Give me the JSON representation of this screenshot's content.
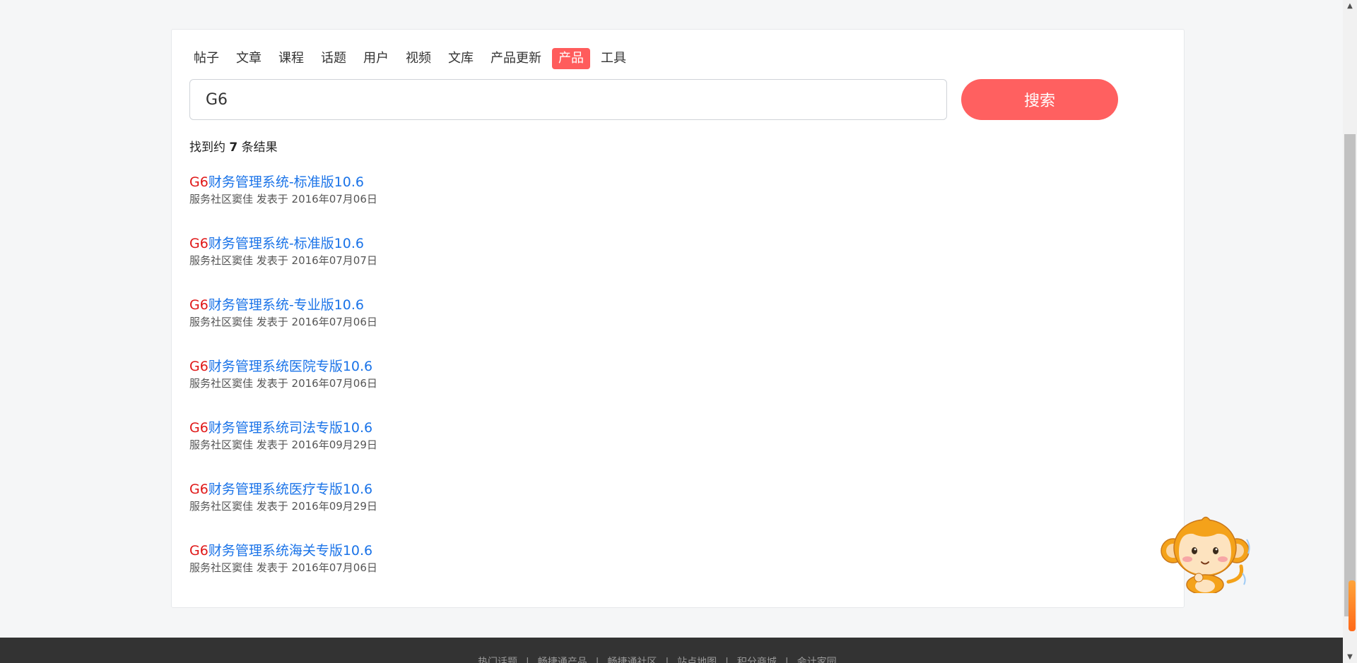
{
  "tabs": [
    {
      "label": "帖子",
      "active": false
    },
    {
      "label": "文章",
      "active": false
    },
    {
      "label": "课程",
      "active": false
    },
    {
      "label": "话题",
      "active": false
    },
    {
      "label": "用户",
      "active": false
    },
    {
      "label": "视频",
      "active": false
    },
    {
      "label": "文库",
      "active": false
    },
    {
      "label": "产品更新",
      "active": false
    },
    {
      "label": "产品",
      "active": true
    },
    {
      "label": "工具",
      "active": false
    }
  ],
  "search": {
    "value": "G6",
    "button_label": "搜索"
  },
  "result_count": {
    "prefix": "找到约 ",
    "count": "7",
    "suffix": " 条结果"
  },
  "results": [
    {
      "highlight": "G6",
      "title": "财务管理系统-标准版10.6",
      "meta": "服务社区窦佳 发表于 2016年07月06日"
    },
    {
      "highlight": "G6",
      "title": "财务管理系统-标准版10.6",
      "meta": "服务社区窦佳 发表于 2016年07月07日"
    },
    {
      "highlight": "G6",
      "title": "财务管理系统-专业版10.6",
      "meta": "服务社区窦佳 发表于 2016年07月06日"
    },
    {
      "highlight": "G6",
      "title": "财务管理系统医院专版10.6",
      "meta": "服务社区窦佳 发表于 2016年07月06日"
    },
    {
      "highlight": "G6",
      "title": "财务管理系统司法专版10.6",
      "meta": "服务社区窦佳 发表于 2016年09月29日"
    },
    {
      "highlight": "G6",
      "title": "财务管理系统医疗专版10.6",
      "meta": "服务社区窦佳 发表于 2016年09月29日"
    },
    {
      "highlight": "G6",
      "title": "财务管理系统海关专版10.6",
      "meta": "服务社区窦佳 发表于 2016年07月06日"
    }
  ],
  "footer": {
    "links": [
      "热门话题",
      "畅捷通产品",
      "畅捷通社区",
      "站点地图",
      "积分商城",
      "会计家园"
    ],
    "separator": "|"
  },
  "colors": {
    "accent": "#ff5c5c",
    "link": "#1a73e8",
    "highlight": "#e01818",
    "footer_bg": "#333333"
  },
  "icons": {
    "mascot": "monkey-mascot-icon"
  }
}
